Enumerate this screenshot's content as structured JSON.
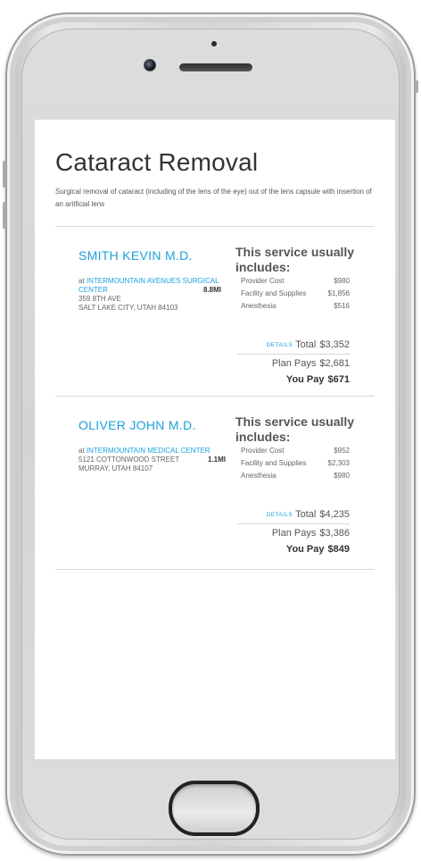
{
  "page": {
    "title": "Cataract Removal",
    "description": "Surgical removal of cataract (including of the lens of the eye) out of the lens capsule with insertion of an artificial lens"
  },
  "labels": {
    "service_includes": "This service usually includes:",
    "details": "DETAILS",
    "total": "Total",
    "plan_pays": "Plan Pays",
    "you_pay": "You Pay",
    "at": "at"
  },
  "providers": [
    {
      "name": "SMITH KEVIN M.D.",
      "facility": "INTERMOUNTAIN AVENUES SURGICAL CENTER",
      "street": "359 8TH AVE",
      "city": "SALT LAKE CITY, UTAH 84103",
      "distance": "8.8MI",
      "costs": [
        {
          "label": "Provider Cost",
          "amount": "$980"
        },
        {
          "label": "Facility and Supplies",
          "amount": "$1,856"
        },
        {
          "label": "Anesthesia",
          "amount": "$516"
        }
      ],
      "total": "$3,352",
      "plan_pays": "$2,681",
      "you_pay": "$671"
    },
    {
      "name": "OLIVER JOHN M.D.",
      "facility": "INTERMOUNTAIN MEDICAL CENTER",
      "street": "5121 COTTONWOOD STREET",
      "city": "MURRAY, UTAH 84107",
      "distance": "1.1MI",
      "costs": [
        {
          "label": "Provider Cost",
          "amount": "$952"
        },
        {
          "label": "Facility and Supplies",
          "amount": "$2,303"
        },
        {
          "label": "Anesthesia",
          "amount": "$980"
        }
      ],
      "total": "$4,235",
      "plan_pays": "$3,386",
      "you_pay": "$849"
    }
  ],
  "colors": {
    "accent": "#1ca1dc",
    "text": "#333333",
    "divider": "#d8d8d8"
  }
}
